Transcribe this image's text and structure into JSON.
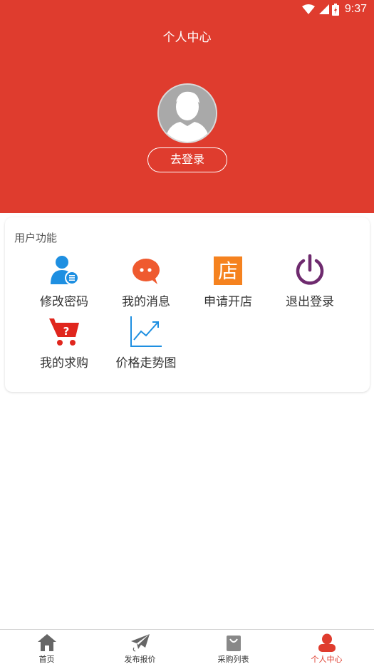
{
  "status_bar": {
    "time": "9:37"
  },
  "header": {
    "title": "个人中心",
    "login_label": "去登录"
  },
  "functions": {
    "section_title": "用户功能",
    "items": [
      {
        "label": "修改密码",
        "icon": "user-settings-icon"
      },
      {
        "label": "我的消息",
        "icon": "chat-bubble-icon"
      },
      {
        "label": "申请开店",
        "icon": "shop-icon"
      },
      {
        "label": "退出登录",
        "icon": "power-icon"
      },
      {
        "label": "我的求购",
        "icon": "cart-question-icon"
      },
      {
        "label": "价格走势图",
        "icon": "trend-chart-icon"
      }
    ]
  },
  "tabbar": {
    "items": [
      {
        "label": "首页",
        "icon": "home-icon"
      },
      {
        "label": "发布报价",
        "icon": "paper-plane-icon"
      },
      {
        "label": "采购列表",
        "icon": "shopping-bag-icon"
      },
      {
        "label": "个人中心",
        "icon": "person-icon",
        "active": true
      }
    ]
  },
  "colors": {
    "brand_red": "#df3c2e",
    "blue": "#1e8fe1",
    "orange": "#f5821f",
    "purple": "#6e2a6e"
  }
}
